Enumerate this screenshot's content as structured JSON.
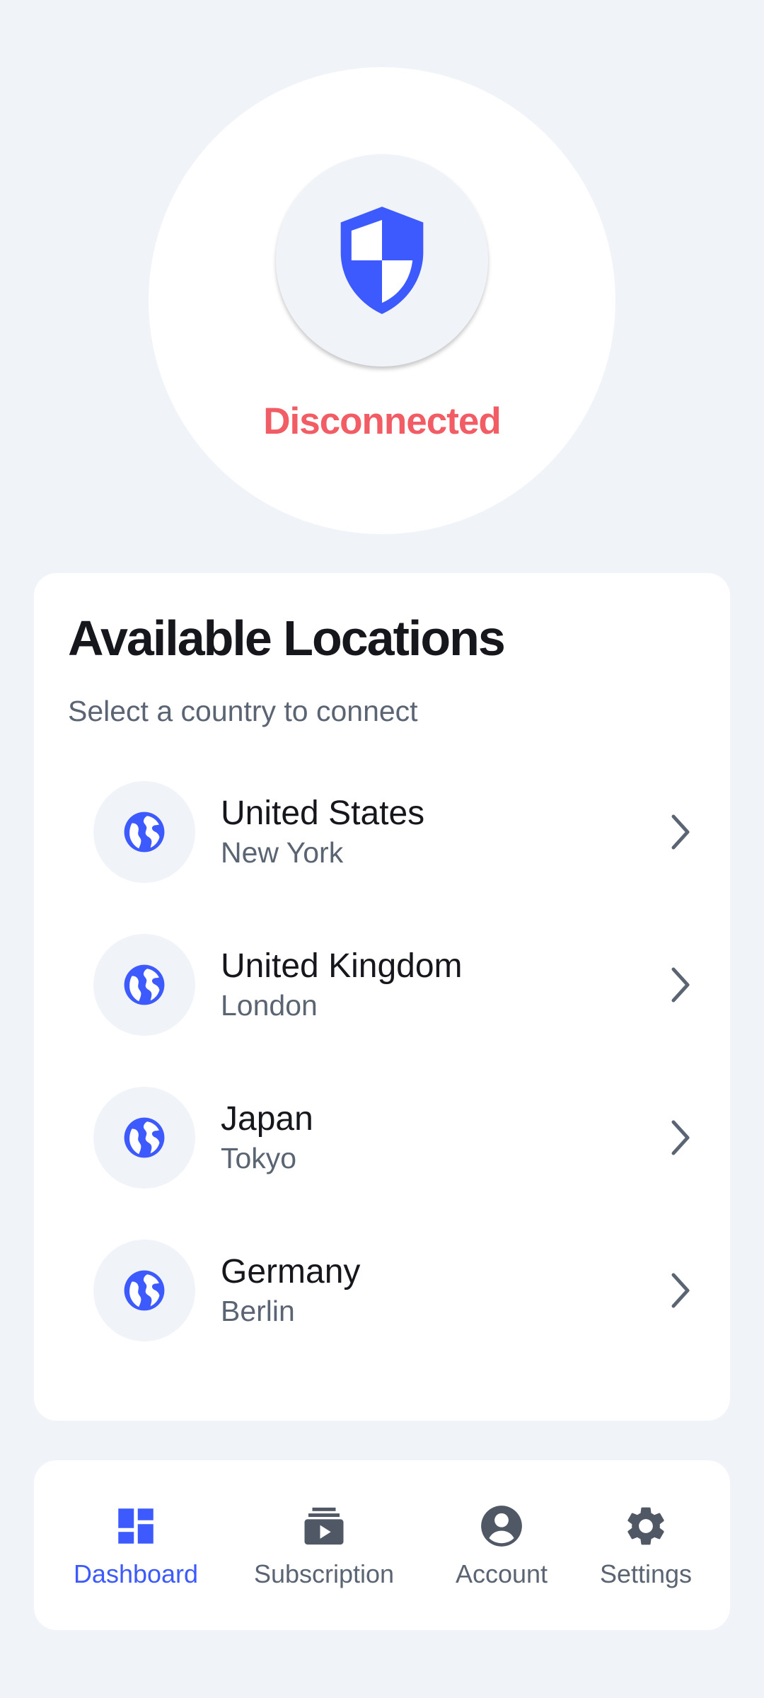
{
  "status": {
    "text": "Disconnected",
    "color": "#f25c64",
    "icon": "shield-icon"
  },
  "locations": {
    "title": "Available Locations",
    "subtitle": "Select a country to connect",
    "items": [
      {
        "country": "United States",
        "city": "New York",
        "icon": "globe-icon"
      },
      {
        "country": "United Kingdom",
        "city": "London",
        "icon": "globe-icon"
      },
      {
        "country": "Japan",
        "city": "Tokyo",
        "icon": "globe-icon"
      },
      {
        "country": "Germany",
        "city": "Berlin",
        "icon": "globe-icon"
      }
    ]
  },
  "nav": {
    "active": "Dashboard",
    "items": [
      {
        "label": "Dashboard",
        "icon": "dashboard-icon"
      },
      {
        "label": "Subscription",
        "icon": "subscription-icon"
      },
      {
        "label": "Account",
        "icon": "account-icon"
      },
      {
        "label": "Settings",
        "icon": "settings-icon"
      }
    ]
  },
  "colors": {
    "accent": "#3d5afe",
    "background": "#f0f3f8",
    "disconnected": "#f25c64",
    "text_primary": "#15171c",
    "text_secondary": "#5b6472"
  }
}
